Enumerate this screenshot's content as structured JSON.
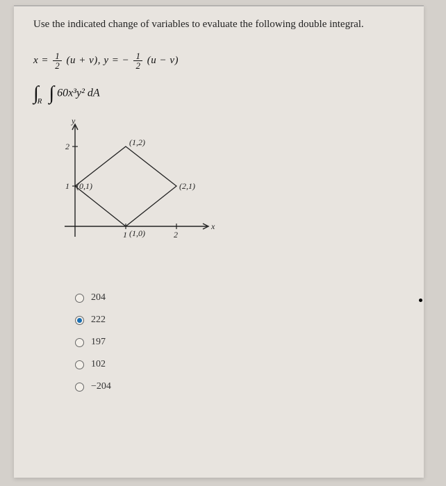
{
  "prompt": "Use the indicated change of variables to evaluate the following double integral.",
  "transform": {
    "x_prefix": "x = ",
    "x_frac_num": "1",
    "x_frac_den": "2",
    "x_suffix": "(u + v), ",
    "y_prefix": "y = − ",
    "y_frac_num": "1",
    "y_frac_den": "2",
    "y_suffix": "(u − v)"
  },
  "integral": {
    "region": "R",
    "integrand": "60x³y² dA"
  },
  "diagram": {
    "y_axis_label": "y",
    "x_axis_label": "x",
    "tick_y": "2",
    "tick_y2": "1",
    "tick_x": "1",
    "tick_x2": "2",
    "vertex_top": "(1,2)",
    "vertex_left": "(0,1)",
    "vertex_right": "(2,1)",
    "vertex_bottom": "(1,0)"
  },
  "options": [
    {
      "label": "204",
      "selected": false
    },
    {
      "label": "222",
      "selected": true
    },
    {
      "label": "197",
      "selected": false
    },
    {
      "label": "102",
      "selected": false
    },
    {
      "label": "−204",
      "selected": false
    }
  ]
}
